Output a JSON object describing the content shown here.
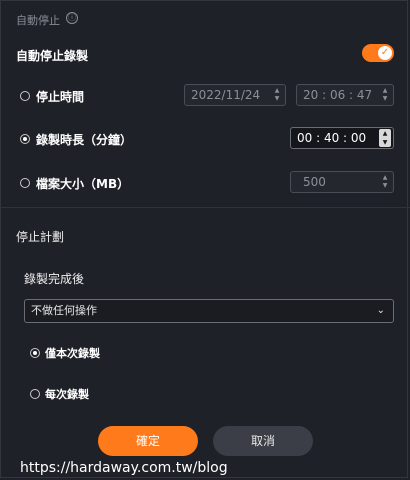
{
  "header": {
    "title": "自動停止",
    "info_icon": "ⓘ"
  },
  "auto_stop": {
    "label": "自動停止錄製",
    "enabled": true
  },
  "options": {
    "stop_time": {
      "label": "停止時間",
      "date": "2022/11/24",
      "time": "20 : 06 : 47",
      "selected": false
    },
    "duration": {
      "label": "錄製時長（分鐘）",
      "value": "00 : 40 : 00",
      "selected": true
    },
    "file_size": {
      "label": "檔案大小（MB）",
      "value": "500",
      "selected": false
    }
  },
  "schedule": {
    "title": "停止計劃",
    "after_label": "錄製完成後",
    "after_select": "不做任何操作",
    "radios": [
      {
        "label": "僅本次錄製",
        "selected": true
      },
      {
        "label": "每次錄製",
        "selected": false
      }
    ]
  },
  "buttons": {
    "ok": "確定",
    "cancel": "取消"
  },
  "watermark": "https://hardaway.com.tw/blog",
  "colors": {
    "accent": "#ff7a1a",
    "background": "#1f2128"
  }
}
